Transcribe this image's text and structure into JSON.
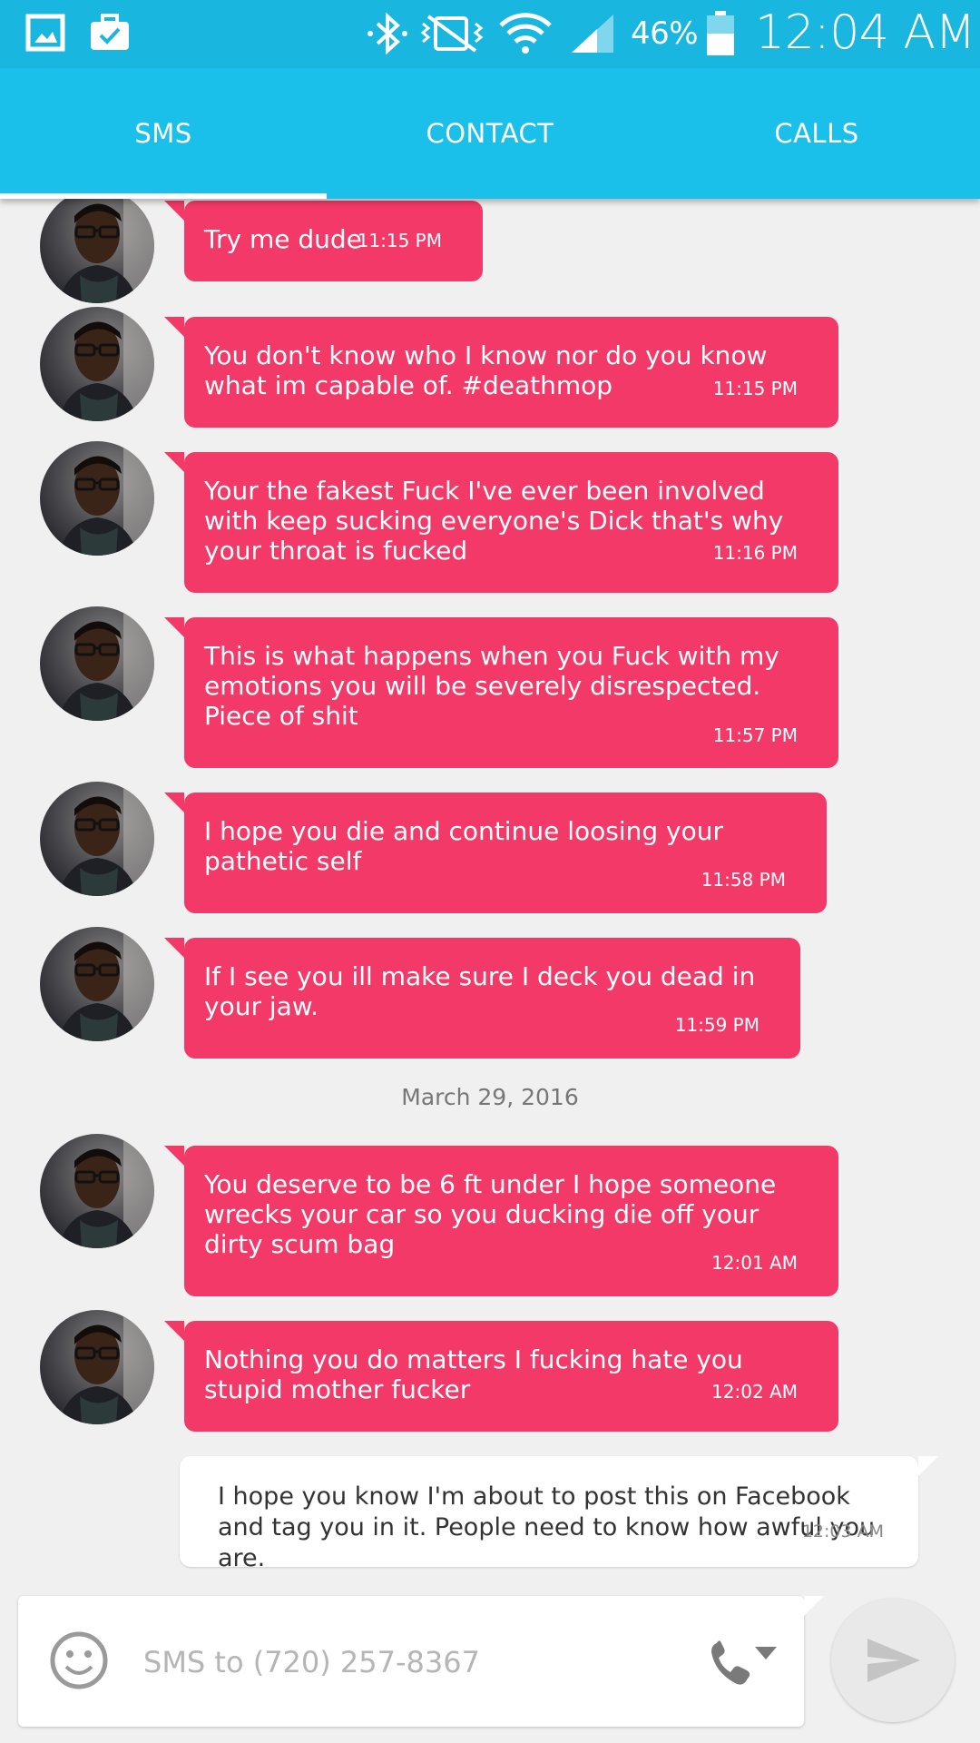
{
  "status_bar": {
    "battery": "46%",
    "time": "12:04 AM",
    "icons": [
      "gallery-icon",
      "briefcase-check-icon",
      "bluetooth-icon",
      "muted-vibrate-icon",
      "wifi-icon",
      "signal-icon",
      "battery-icon"
    ]
  },
  "tabs": [
    {
      "label": "SMS",
      "active": true
    },
    {
      "label": "CONTACT",
      "active": false
    },
    {
      "label": "CALLS",
      "active": false
    }
  ],
  "colors": {
    "accent": "#1ac0ea",
    "incoming_bubble": "#f33968",
    "outgoing_bubble": "#ffffff"
  },
  "messages": [
    {
      "text": "Try me dude",
      "time": "11:15 PM"
    },
    {
      "text": "You don't know who I know nor do you know what im capable of. #deathmop",
      "time": "11:15 PM"
    },
    {
      "text": "Your the fakest Fuck I've ever been involved with keep sucking everyone's Dick that's why your throat is fucked",
      "time": "11:16 PM"
    },
    {
      "text": "This is what happens when you Fuck with my emotions you will be severely disrespected. Piece of shit",
      "time": "11:57 PM"
    },
    {
      "text": "I hope you die and continue loosing your pathetic self",
      "time": "11:58 PM"
    },
    {
      "text": "If I see you ill make sure I deck you dead in your jaw.",
      "time": "11:59 PM"
    },
    {
      "text": "You deserve to be 6 ft under I hope someone wrecks your car so you ducking die off your dirty scum bag",
      "time": "12:01 AM"
    },
    {
      "text": "Nothing you do matters I fucking hate you stupid mother fucker",
      "time": "12:02 AM"
    }
  ],
  "date_separator": "March 29, 2016",
  "outgoing": {
    "text": "I hope you know I'm about to post this on Facebook and tag you in it. People need to know how awful you are.",
    "time": "12:03 AM"
  },
  "composer": {
    "placeholder": "SMS to (720) 257-8367"
  }
}
